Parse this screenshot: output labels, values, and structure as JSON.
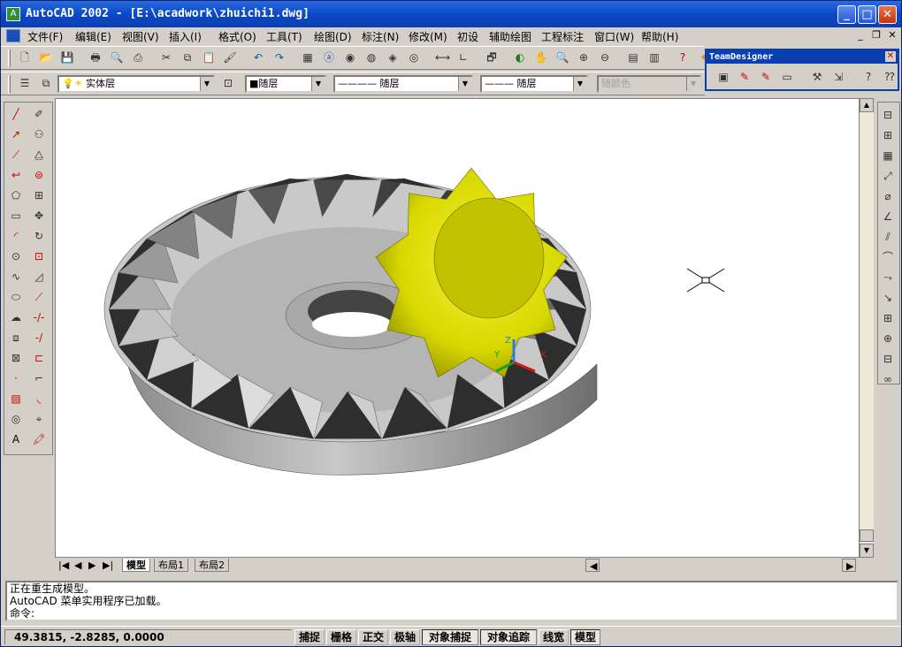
{
  "title": "AutoCAD 2002 - [E:\\acadwork\\zhuichi1.dwg]",
  "menus": [
    "文件(F)",
    "编辑(E)",
    "视图(V)",
    "插入(I)",
    "格式(O)",
    "工具(T)",
    "绘图(D)",
    "标注(N)",
    "修改(M)",
    "初设",
    "辅助绘图",
    "工程标注",
    "窗口(W)",
    "帮助(H)"
  ],
  "layer": {
    "name": "实体层",
    "color": "■随层",
    "linetype": "———— 随层",
    "lineweight": "——— 随层",
    "plotstyle": "随颜色"
  },
  "team_designer": {
    "title": "TeamDesigner"
  },
  "tabs": [
    "模型",
    "布局1",
    "布局2"
  ],
  "command_lines": [
    "正在重生成模型。",
    "AutoCAD 菜单实用程序已加载。",
    "命令:"
  ],
  "status": {
    "coords": "49.3815, -2.8285, 0.0000",
    "buttons": [
      "捕捉",
      "栅格",
      "正交",
      "极轴",
      "对象捕捉",
      "对象追踪",
      "线宽",
      "模型"
    ]
  },
  "ucs": {
    "x": "X",
    "y": "Y",
    "z": "Z"
  },
  "colors": {
    "title_bar": "#0b48c8",
    "gear_gray": "#b8b8b8",
    "pinion_yellow": "#e6e61a"
  }
}
